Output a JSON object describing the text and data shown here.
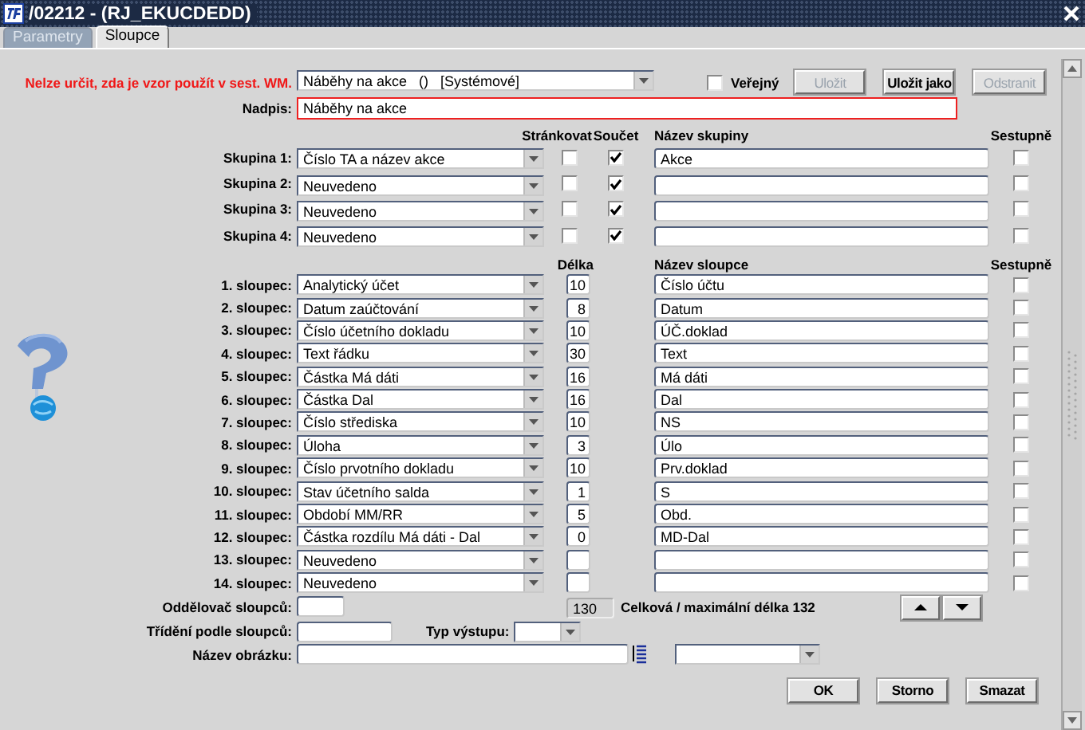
{
  "window": {
    "title": "/02212 - (RJ_EKUCDEDD)"
  },
  "tabs": [
    {
      "label": "Parametry",
      "selected": false
    },
    {
      "label": "Sloupce",
      "selected": true
    }
  ],
  "template": {
    "warning": "Nelze určit, zda je vzor použít v sest. WM.",
    "value": "Náběhy na akce   ()   [Systémové]",
    "public_label": "Veřejný",
    "public": false
  },
  "actions": [
    {
      "label": "Uložit",
      "disabled": true
    },
    {
      "label": "Uložit jako",
      "disabled": false
    },
    {
      "label": "Odstranit",
      "disabled": true
    }
  ],
  "heading": {
    "label": "Nadpis:",
    "value": "Náběhy na akce"
  },
  "group_headers": {
    "paging": "Stránkovat",
    "sum": "Součet",
    "name": "Název skupiny",
    "descending": "Sestupně"
  },
  "groups": [
    {
      "label": "Skupina 1:",
      "value": "Číslo TA a název akce",
      "paging": false,
      "sum": true,
      "name": "Akce",
      "descending": false
    },
    {
      "label": "Skupina 2:",
      "value": "Neuvedeno",
      "paging": false,
      "sum": true,
      "descending": false
    },
    {
      "label": "Skupina 3:",
      "value": "Neuvedeno",
      "paging": false,
      "sum": true,
      "descending": false
    },
    {
      "label": "Skupina 4:",
      "value": "Neuvedeno",
      "paging": false,
      "sum": true,
      "descending": false
    }
  ],
  "column_headers": {
    "length": "Délka",
    "name": "Název sloupce",
    "descending": "Sestupně"
  },
  "columns": [
    {
      "label": "1. sloupec:",
      "value": "Analytický účet",
      "length": "10",
      "name": "Číslo účtu",
      "descending": false
    },
    {
      "label": "2. sloupec:",
      "value": "Datum zaúčtování",
      "length": "8",
      "name": "Datum",
      "descending": false
    },
    {
      "label": "3. sloupec:",
      "value": "Číslo účetního dokladu",
      "length": "10",
      "name": "ÚČ.doklad",
      "descending": false
    },
    {
      "label": "4. sloupec:",
      "value": "Text řádku",
      "length": "30",
      "name": "Text",
      "descending": false
    },
    {
      "label": "5. sloupec:",
      "value": "Částka Má dáti",
      "length": "16",
      "name": "Má dáti",
      "descending": false
    },
    {
      "label": "6. sloupec:",
      "value": "Částka Dal",
      "length": "16",
      "name": "Dal",
      "descending": false
    },
    {
      "label": "7. sloupec:",
      "value": "Číslo střediska",
      "length": "10",
      "name": "NS",
      "descending": false
    },
    {
      "label": "8. sloupec:",
      "value": "Úloha",
      "length": "3",
      "name": "Úlo",
      "descending": false
    },
    {
      "label": "9. sloupec:",
      "value": "Číslo prvotního dokladu",
      "length": "10",
      "name": "Prv.doklad",
      "descending": false
    },
    {
      "label": "10. sloupec:",
      "value": "Stav účetního salda",
      "length": "1",
      "name": "S",
      "descending": false
    },
    {
      "label": "11. sloupec:",
      "value": "Období MM/RR",
      "length": "5",
      "name": "Obd.",
      "descending": false
    },
    {
      "label": "12. sloupec:",
      "value": "Částka rozdílu Má dáti - Dal",
      "length": "0",
      "name": "MD-Dal",
      "descending": false
    },
    {
      "label": "13. sloupec:",
      "value": "Neuvedeno",
      "descending": false
    },
    {
      "label": "14. sloupec:",
      "value": "Neuvedeno",
      "descending": false
    }
  ],
  "separator": {
    "label": "Oddělovač sloupců:"
  },
  "total": {
    "value": "130",
    "label": "Celková / maximální délka 132"
  },
  "sort": {
    "label": "Třídění podle sloupců:"
  },
  "output_type": {
    "label": "Typ výstupu:"
  },
  "image_name": {
    "label": "Název obrázku:"
  },
  "buttons": [
    {
      "label": "OK"
    },
    {
      "label": "Storno"
    },
    {
      "label": "Smazat"
    }
  ]
}
